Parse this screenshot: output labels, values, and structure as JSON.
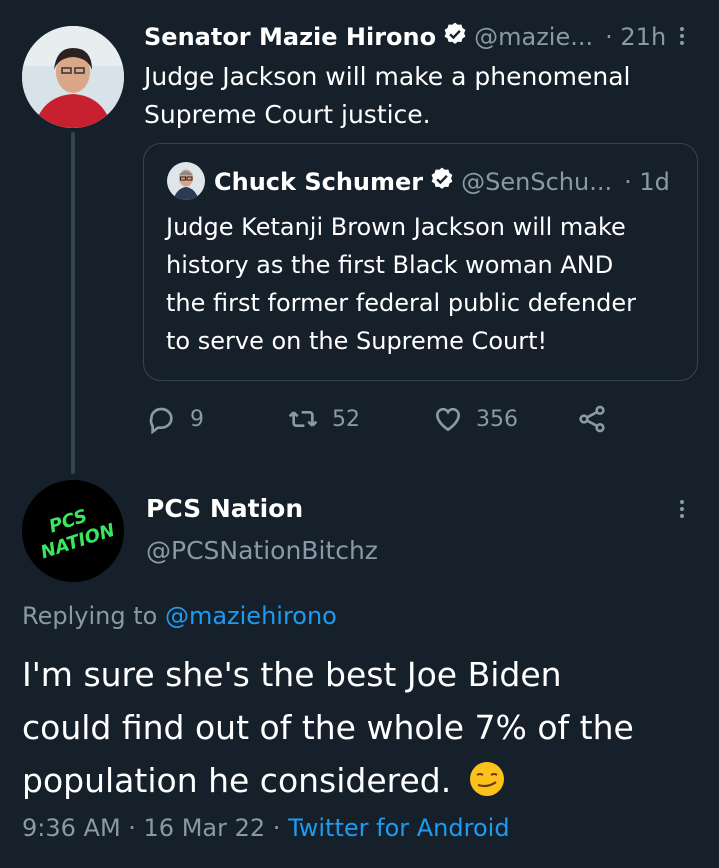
{
  "tweet1": {
    "display_name": "Senator Mazie Hirono",
    "handle": "@mazie...",
    "time": "· 21h",
    "text_line1": "Judge Jackson will make a phenomenal",
    "text_line2": "Supreme Court justice.",
    "quote": {
      "display_name": "Chuck Schumer",
      "handle": "@SenSchu...",
      "time": "· 1d",
      "lines": [
        "Judge Ketanji Brown Jackson will make",
        "history as the first Black woman AND",
        "the first former federal public defender",
        "to serve on the Supreme Court!"
      ]
    },
    "actions": {
      "replies": "9",
      "retweets": "52",
      "likes": "356"
    }
  },
  "tweet2": {
    "display_name": "PCS Nation",
    "handle": "@PCSNationBitchz",
    "avatar_text": "PCS NATION",
    "replying_prefix": "Replying to",
    "replying_handle": "@maziehirono",
    "text_lines": [
      "I'm sure she's the best Joe Biden",
      "could find out of the whole 7% of the",
      "population he considered."
    ],
    "emoji": "😏",
    "timestamp": "9:36 AM · 16 Mar 22 ·",
    "source": "Twitter for Android"
  },
  "colors": {
    "background": "#15202b",
    "accent": "#1d9bf0",
    "muted": "#8b98a5",
    "border": "#38444d",
    "pcs_green": "#39e75f"
  },
  "icons": [
    "verified-badge-icon",
    "more-options-icon",
    "reply-icon",
    "retweet-icon",
    "like-icon",
    "share-icon"
  ]
}
